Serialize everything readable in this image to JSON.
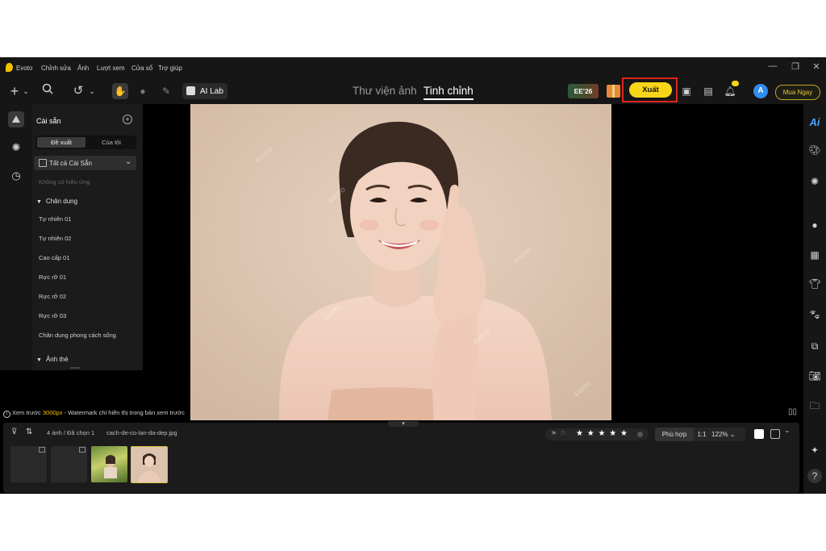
{
  "app": {
    "name": "Evoto",
    "menu": [
      "Chỉnh sửa",
      "Ảnh",
      "Lượt xem",
      "Cửa sổ",
      "Trợ giúp"
    ]
  },
  "toolbar": {
    "ai_lab_label": "AI Lab",
    "tabs": [
      {
        "label": "Thư viện ảnh",
        "active": false
      },
      {
        "label": "Tinh chỉnh",
        "active": true
      }
    ],
    "promo_label": "EE'26",
    "export_label": "Xuất",
    "avatar_letter": "A",
    "buy_label": "Mua Ngay"
  },
  "preset_panel": {
    "title": "Cài sẵn",
    "segments": [
      "Đề xuất",
      "Của tôi"
    ],
    "filter_label": "Tất cả Cài Sẵn",
    "no_effect": "Không có hiệu ứng",
    "sections": [
      {
        "label": "Chân dung",
        "items": [
          "Tự nhiên 01",
          "Tự nhiên 02",
          "Cao cấp 01",
          "Rực rỡ 01",
          "Rực rỡ 02",
          "Rực rỡ 03",
          "Chân dung phong cách sống"
        ]
      },
      {
        "label": "Ảnh thẻ",
        "items": []
      }
    ]
  },
  "canvas": {
    "watermark": "EVOTO",
    "preview_prefix": "Xem trước ",
    "preview_size": "3000px",
    "preview_suffix": " - Watermark chỉ hiển thị trong bản xem trước"
  },
  "filmstrip": {
    "count_label": "4 ảnh / Đã chọn 1",
    "filename": "cach-de-co-lan-da-dep.jpg",
    "stars": "★ ★ ★ ★ ★",
    "fit_label": "Phù hợp",
    "one_to_one": "1:1",
    "zoom": "122%",
    "thumbnails": [
      {
        "kind": "empty",
        "selected": false
      },
      {
        "kind": "empty",
        "selected": false
      },
      {
        "kind": "landscape",
        "selected": false
      },
      {
        "kind": "portrait",
        "selected": true
      }
    ]
  },
  "colors": {
    "accent_yellow": "#f7d619",
    "highlight_red": "#e2241f",
    "ai_blue": "#4aa3ff",
    "avatar_blue": "#2f8cf0"
  }
}
